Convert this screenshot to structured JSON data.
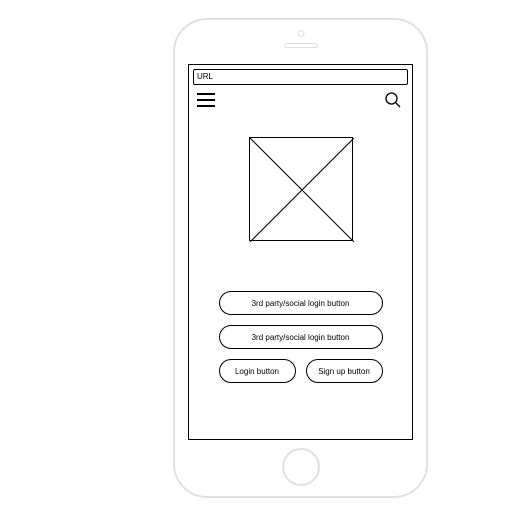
{
  "url_bar": {
    "label": "URL"
  },
  "buttons": {
    "social1": "3rd party/social login button",
    "social2": "3rd party/social login button",
    "login": "Login button",
    "signup": "Sign up button"
  }
}
